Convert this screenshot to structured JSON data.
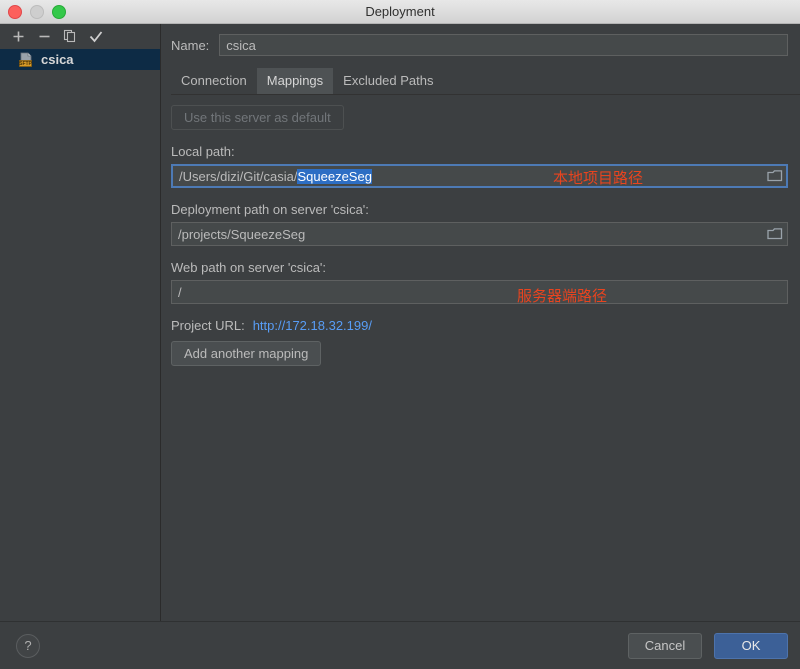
{
  "window": {
    "title": "Deployment",
    "controls": {
      "close": "close-button",
      "minimize": "minimize-button",
      "maximize": "maximize-button"
    }
  },
  "sidebar": {
    "toolbar": [
      {
        "name": "add-server-button",
        "glyph": "+",
        "label": "Add"
      },
      {
        "name": "remove-server-button",
        "glyph": "−",
        "label": "Remove"
      },
      {
        "name": "copy-server-button",
        "glyph": "copy-icon",
        "label": "Copy"
      },
      {
        "name": "set-default-button",
        "glyph": "✓",
        "label": "Use as default"
      }
    ],
    "servers": [
      {
        "name": "csica",
        "icon": "sftp-server-icon",
        "selected": true
      }
    ]
  },
  "form": {
    "name_label": "Name:",
    "name_value": "csica"
  },
  "tabs": [
    {
      "label": "Connection",
      "active": false
    },
    {
      "label": "Mappings",
      "active": true
    },
    {
      "label": "Excluded Paths",
      "active": false
    }
  ],
  "mappings": {
    "use_default_button": "Use this server as default",
    "local_path_label": "Local path:",
    "local_path_prefix": "/Users/dizi/Git/casia/",
    "local_path_selected": "SqueezeSeg",
    "deployment_path_label": "Deployment path on server 'csica':",
    "deployment_path_value": "/projects/SqueezeSeg",
    "web_path_label": "Web path on server 'csica':",
    "web_path_value": "/",
    "project_url_label": "Project URL:",
    "project_url_value": "http://172.18.32.199/",
    "add_mapping_button": "Add another mapping"
  },
  "annotations": [
    {
      "text": "本地项目路径",
      "name": "annotation-local-path",
      "color": "#e8441f"
    },
    {
      "text": "服务器端路径",
      "name": "annotation-server-path",
      "color": "#e8441f"
    }
  ],
  "footer": {
    "help_label": "?",
    "cancel_label": "Cancel",
    "ok_label": "OK"
  },
  "colors": {
    "background": "#3c3f41",
    "field_background": "#45494a",
    "selection_blue": "#2d6ec4",
    "focus_border": "#4d7ab5",
    "link_blue": "#589df6",
    "accent_ok": "#3c6097",
    "annotation_red": "#e8441f",
    "selected_row": "#0d2b45"
  }
}
